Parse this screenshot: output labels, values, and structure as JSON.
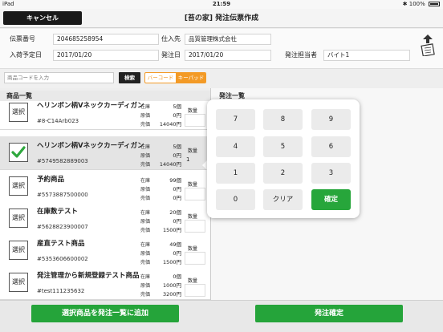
{
  "status": {
    "device": "iPad",
    "time": "21:59",
    "battery": "100%"
  },
  "nav": {
    "cancel_label": "キャンセル",
    "title": "[苔の家] 発注伝票作成"
  },
  "header": {
    "slip_no_label": "伝票番号",
    "slip_no": "204685258954",
    "supplier_label": "仕入先",
    "supplier": "品質管理株式会社",
    "arrival_label": "入荷予定日",
    "arrival": "2017/01/20",
    "order_date_label": "発注日",
    "order_date": "2017/01/20",
    "staff_label": "発注担当者",
    "staff": "バイト1"
  },
  "search": {
    "placeholder": "商品コードを入力",
    "button": "検索",
    "barcode": "バーコード",
    "keypad": "キーパッド"
  },
  "list": {
    "title": "商品一覧",
    "select_label": "選択",
    "stock_label": "在庫",
    "cost_label": "原価",
    "price_label": "売価",
    "qty_label": "数量",
    "items": [
      {
        "name": "ヘリンボン柄Vネックカーディガン",
        "code": "#8-C14Arb023",
        "stock": "5個",
        "cost": "0円",
        "price": "14040円",
        "qty": "",
        "selected": false
      },
      {
        "name": "ヘリンボン柄Vネックカーディガン",
        "code": "#5749582889003",
        "stock": "5個",
        "cost": "0円",
        "price": "14040円",
        "qty": "1",
        "selected": true
      },
      {
        "name": "予約商品",
        "code": "#5573887500000",
        "stock": "99個",
        "cost": "0円",
        "price": "0円",
        "qty": "",
        "selected": false
      },
      {
        "name": "在庫数テスト",
        "code": "#5628823900007",
        "stock": "20個",
        "cost": "0円",
        "price": "1500円",
        "qty": "",
        "selected": false
      },
      {
        "name": "産直テスト商品",
        "code": "#5353606600002",
        "stock": "49個",
        "cost": "0円",
        "price": "1500円",
        "qty": "",
        "selected": false
      },
      {
        "name": "発注管理から新規登録テスト商品",
        "code": "#test111235632",
        "stock": "0個",
        "cost": "1000円",
        "price": "3200円",
        "qty": "",
        "selected": false
      }
    ]
  },
  "order": {
    "title": "発注一覧"
  },
  "keypad": {
    "keys": [
      "7",
      "8",
      "9",
      "4",
      "5",
      "6",
      "1",
      "2",
      "3",
      "0",
      "クリア",
      "確定"
    ]
  },
  "buttons": {
    "add_selected": "選択商品を発注一覧に追加",
    "confirm_order": "発注確定"
  },
  "colors": {
    "accent_green": "#25a43a",
    "accent_orange": "#f39a26"
  }
}
